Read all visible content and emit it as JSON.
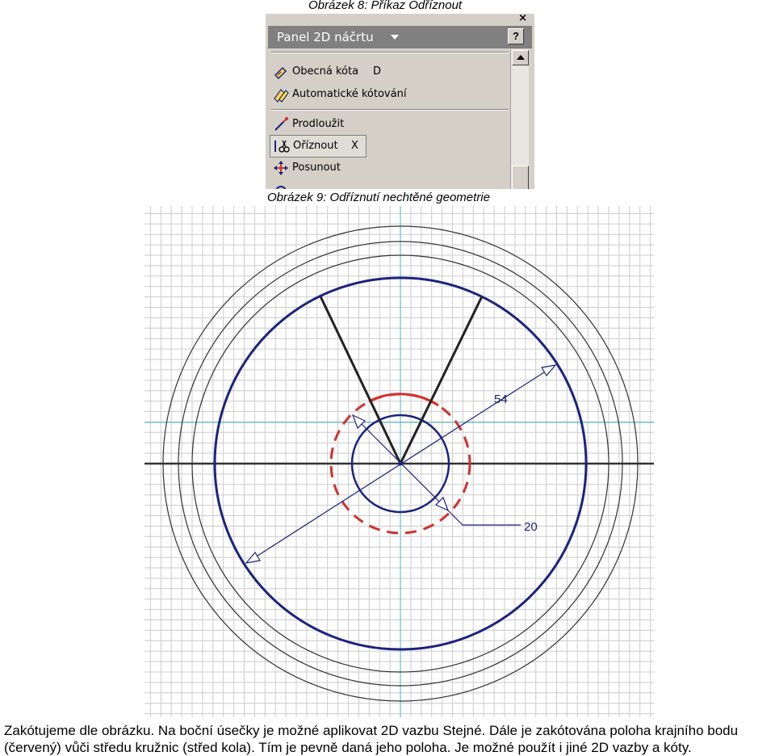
{
  "captions": {
    "figure8": "Obrázek 8: Příkaz Odříznout",
    "figure9": "Obrázek 9: Odříznutí nechtěné geometrie"
  },
  "panel": {
    "close_glyph": "×",
    "title": "Panel 2D náčrtu",
    "help_glyph": "?",
    "items": [
      {
        "label": "Obecná kóta",
        "shortcut": "D",
        "icon": "general-dimension-icon"
      },
      {
        "label": "Automatické kótování",
        "shortcut": "",
        "icon": "auto-dimension-icon"
      },
      {
        "label": "Prodloužit",
        "shortcut": "",
        "icon": "extend-icon"
      },
      {
        "label": "Oříznout",
        "shortcut": "X",
        "icon": "trim-icon",
        "selected": true
      },
      {
        "label": "Posunout",
        "shortcut": "",
        "icon": "move-icon"
      }
    ]
  },
  "drawing": {
    "dimensions": [
      {
        "name": "diameter-dimension",
        "value": "54"
      },
      {
        "name": "radius-dimension",
        "value": "20"
      }
    ],
    "colors": {
      "grid": "#c8c8c8",
      "circle_dark": "#1a237e",
      "circle_thin": "#333333",
      "trimmed_red": "#d32f2f",
      "axis_cyan": "#4fb3bf",
      "dimension_blue": "#1a237e"
    }
  },
  "text": {
    "paragraph_line1": "Zakótujeme dle obrázku. Na boční úsečky je možné aplikovat 2D vazbu Stejné. Dále je zakótována poloha krajního bodu",
    "paragraph_line2": "(červený) vůči středu kružnic (střed kola). Tím je pevně daná jeho poloha. Je možné použít i jiné 2D vazby a kóty."
  }
}
